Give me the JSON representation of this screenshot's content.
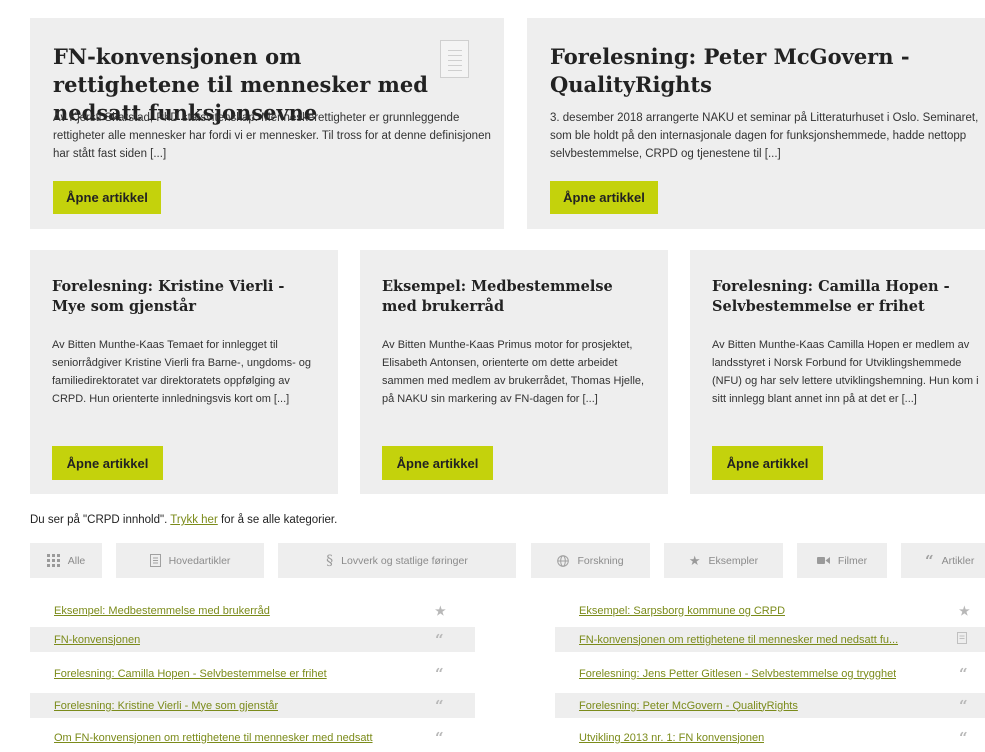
{
  "featured": [
    {
      "title": "FN-konvensjonen om rettighetene til mennesker med nedsatt funksjonsevne",
      "excerpt": "Av Kjersti Skarstad, PhD statsvitenskap. Menneskerettigheter er grunnleggende rettigheter alle mennesker har fordi vi er mennesker. Til tross for at denne definisjonen har stått fast siden [...]",
      "button": "Åpne artikkel",
      "icon": "document-icon"
    },
    {
      "title": "Forelesning: Peter McGovern - QualityRights",
      "excerpt": "3. desember 2018 arrangerte NAKU et seminar på Litteraturhuset i Oslo. Seminaret, som ble holdt på den internasjonale dagen for funksjonshemmede, hadde nettopp selvbestemmelse, CRPD og tjenestene til [...]",
      "button": "Åpne artikkel"
    }
  ],
  "articles": [
    {
      "title": "Forelesning: Kristine Vierli - Mye som gjenstår",
      "excerpt": "Av Bitten Munthe-Kaas Temaet for innlegget til seniorrådgiver Kristine Vierli fra Barne-, ungdoms- og familiedirektoratet var direktoratets oppfølging av CRPD. Hun orienterte innledningsvis kort om [...]",
      "button": "Åpne artikkel"
    },
    {
      "title": "Eksempel: Medbestemmelse med brukerråd",
      "excerpt": "Av Bitten Munthe-Kaas Primus motor for prosjektet, Elisabeth Antonsen, orienterte om dette arbeidet sammen med medlem av brukerrådet, Thomas Hjelle, på NAKU sin markering av FN-dagen for [...]",
      "button": "Åpne artikkel"
    },
    {
      "title": "Forelesning: Camilla Hopen - Selvbestemmelse er frihet",
      "excerpt": "Av Bitten Munthe-Kaas Camilla Hopen er medlem av landsstyret i Norsk Forbund for Utviklingshemmede (NFU) og har selv lettere utviklingshemning. Hun kom i sitt innlegg blant annet inn på at det er [...]",
      "button": "Åpne artikkel"
    }
  ],
  "notice": {
    "before": "Du ser på \"CRPD innhold\". ",
    "link": "Trykk her",
    "after": " for å se alle kategorier."
  },
  "filters": [
    {
      "label": "Alle",
      "icon": "grid-icon"
    },
    {
      "label": "Hovedartikler",
      "icon": "document-icon"
    },
    {
      "label": "Lovverk og statlige føringer",
      "icon": "section-icon"
    },
    {
      "label": "Forskning",
      "icon": "globe-icon"
    },
    {
      "label": "Eksempler",
      "icon": "star-icon"
    },
    {
      "label": "Filmer",
      "icon": "video-icon"
    },
    {
      "label": "Artikler",
      "icon": "quote-icon"
    }
  ],
  "list_left": [
    {
      "title": "Eksempel: Medbestemmelse med brukerråd",
      "icon": "star-icon"
    },
    {
      "title": "FN-konvensjonen",
      "icon": "quote-icon"
    },
    {
      "title": "Forelesning: Camilla Hopen - Selvbestemmelse er frihet",
      "icon": "quote-icon"
    },
    {
      "title": "Forelesning: Kristine Vierli - Mye som gjenstår",
      "icon": "quote-icon"
    },
    {
      "title": "Om FN-konvensjonen om rettighetene til mennesker med nedsatt",
      "icon": "quote-icon"
    }
  ],
  "list_right": [
    {
      "title": "Eksempel: Sarpsborg kommune og CRPD",
      "icon": "star-icon"
    },
    {
      "title": "FN-konvensjonen om rettighetene til mennesker med nedsatt fu...",
      "icon": "document-icon"
    },
    {
      "title": "Forelesning: Jens Petter Gitlesen - Selvbestemmelse og trygghet",
      "icon": "quote-icon"
    },
    {
      "title": "Forelesning: Peter McGovern - QualityRights",
      "icon": "quote-icon"
    },
    {
      "title": "Utvikling 2013 nr. 1: FN konvensjonen",
      "icon": "quote-icon"
    }
  ]
}
